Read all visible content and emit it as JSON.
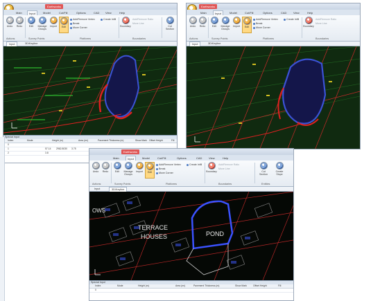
{
  "ribbon_tabs": [
    "Main",
    "Input",
    "Model",
    "Cut/Fill",
    "Options",
    "CAD",
    "View",
    "Help"
  ],
  "app_label": "Earthworks",
  "buttons": {
    "undo": "Undo",
    "redo": "Redo",
    "edit": "Edit",
    "manage_groups": "Manage Groups",
    "import": "Import",
    "edit_platform": "Edit",
    "add_remove_vertex": "Add/Remove Vertex",
    "create_infill": "Create Infill",
    "break": "Break",
    "move_corner": "Move Corner",
    "boundary": "Boundary",
    "add_remove_ratio": "Add/Remove Ratio",
    "move_line": "Move Line",
    "cut_section": "Cut Section",
    "create_slope": "Create Slope"
  },
  "groups": {
    "actions": "Actions",
    "survey_points": "Survey Points",
    "platforms": "Platforms",
    "boundaries": "Boundaries",
    "entities": "Entities"
  },
  "view_tabs": {
    "input": "Input",
    "pitworks": "3D/Keyline"
  },
  "canvas_labels": {
    "terrace": "TERRACE",
    "houses": "HOUSES",
    "pond": "POND",
    "ows": "OWS"
  },
  "special_input": {
    "title": "Special Input",
    "columns": [
      "Index",
      "Mode",
      "Height (m)",
      "Area (m²)",
      "Pavement Thickness (m)",
      "Show Mark",
      "Offset Height",
      "Fill"
    ],
    "rows": [
      [
        "0",
        "",
        "",
        "",
        "",
        "",
        "",
        ""
      ],
      [
        "1",
        "",
        "57.14",
        "2962.8030",
        "3.75",
        "",
        "",
        ""
      ],
      [
        "2",
        "",
        "3.8",
        "",
        "",
        "",
        "",
        ""
      ]
    ]
  }
}
